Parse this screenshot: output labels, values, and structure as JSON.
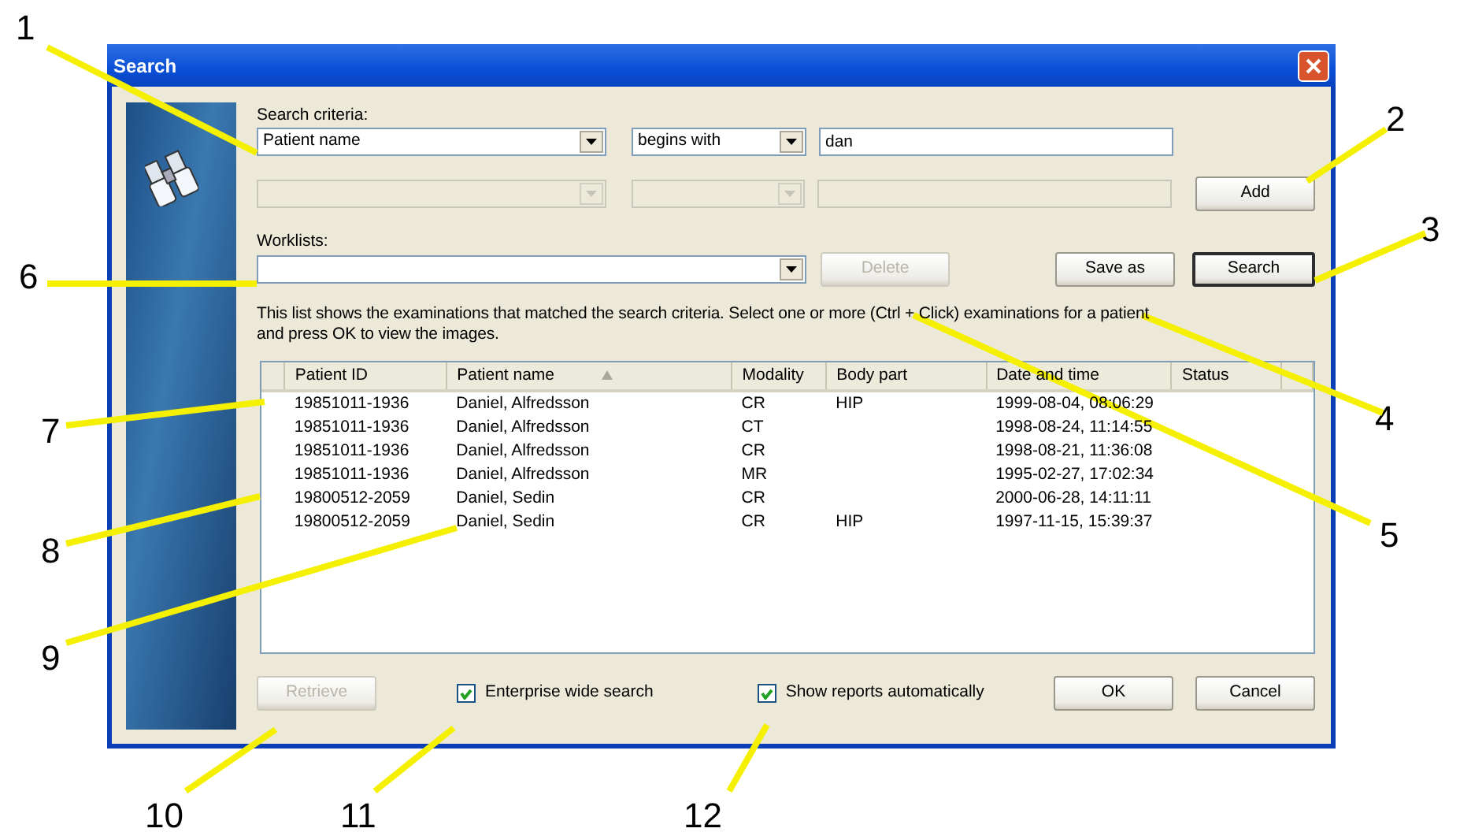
{
  "window": {
    "title": "Search"
  },
  "search_criteria": {
    "label": "Search criteria:",
    "rows": [
      {
        "field": "Patient name",
        "operator": "begins with",
        "value": "dan",
        "disabled": false
      },
      {
        "disabled": true
      }
    ]
  },
  "add_button": {
    "label": "Add"
  },
  "worklists": {
    "label": "Worklists:"
  },
  "delete_button": {
    "label": "Delete",
    "disabled": true
  },
  "save_as_button": {
    "label": "Save as"
  },
  "search_button": {
    "label": "Search",
    "default": true
  },
  "description": "This list shows the examinations that matched the search criteria. Select one or more (Ctrl + Click) examinations for a patient and press OK to view the images.",
  "table": {
    "columns": [
      {
        "label": "Patient ID",
        "sorted": false
      },
      {
        "label": "Patient name",
        "sorted": true
      },
      {
        "label": "Modality",
        "sorted": false
      },
      {
        "label": "Body part",
        "sorted": false
      },
      {
        "label": "Date and time",
        "sorted": false
      },
      {
        "label": "Status",
        "sorted": false
      }
    ],
    "rows": [
      [
        "19851011-1936",
        "Daniel, Alfredsson",
        "CR",
        "HIP",
        "1999-08-04, 08:06:29"
      ],
      [
        "19851011-1936",
        "Daniel, Alfredsson",
        "CT",
        "",
        "1998-08-24, 11:14:55"
      ],
      [
        "19851011-1936",
        "Daniel, Alfredsson",
        "CR",
        "",
        "1998-08-21, 11:36:08"
      ],
      [
        "19851011-1936",
        "Daniel, Alfredsson",
        "MR",
        "",
        "1995-02-27, 17:02:34"
      ],
      [
        "19800512-2059",
        "Daniel, Sedin",
        "CR",
        "",
        "2000-06-28, 14:11:11"
      ],
      [
        "19800512-2059",
        "Daniel, Sedin",
        "CR",
        "HIP",
        "1997-11-15, 15:39:37"
      ]
    ]
  },
  "retrieve_button": {
    "label": "Retrieve",
    "disabled": true
  },
  "checkboxes": [
    {
      "label": "Enterprise wide search",
      "checked": true
    },
    {
      "label": "Show reports automatically",
      "checked": true
    }
  ],
  "ok_button": {
    "label": "OK"
  },
  "cancel_button": {
    "label": "Cancel"
  },
  "callouts": [
    {
      "number": "1"
    },
    {
      "number": "2"
    },
    {
      "number": "3"
    },
    {
      "number": "4"
    },
    {
      "number": "5"
    },
    {
      "number": "6"
    },
    {
      "number": "7"
    },
    {
      "number": "8"
    },
    {
      "number": "9"
    },
    {
      "number": "10"
    },
    {
      "number": "11"
    },
    {
      "number": "12"
    }
  ]
}
